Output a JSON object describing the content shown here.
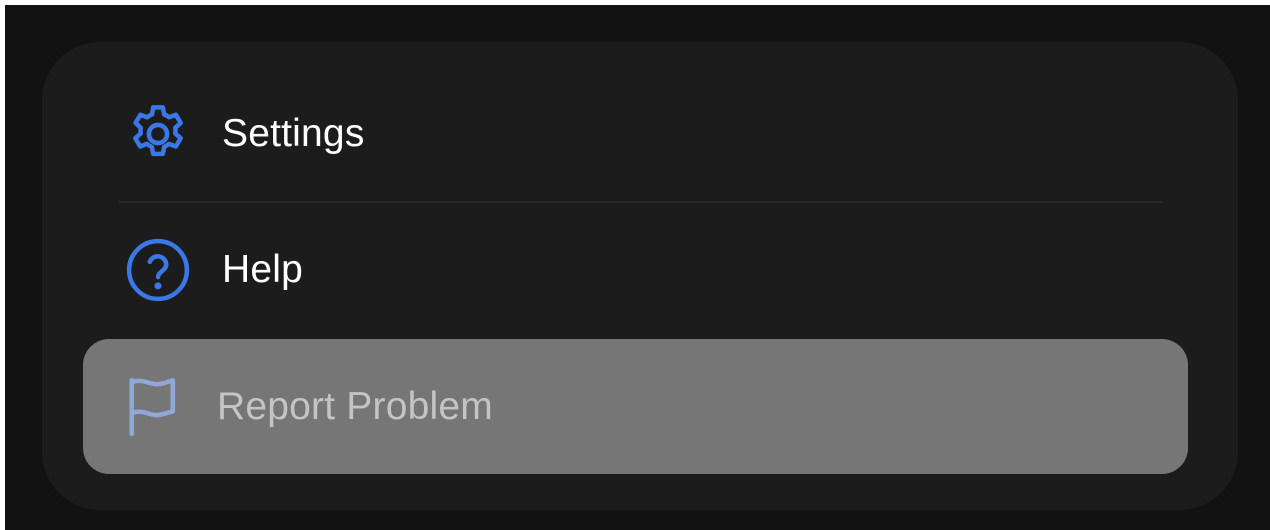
{
  "menu": {
    "items": [
      {
        "label": "Settings",
        "icon": "gear-icon"
      },
      {
        "label": "Help",
        "icon": "question-circle-icon"
      },
      {
        "label": "Report Problem",
        "icon": "flag-icon",
        "state": "highlighted"
      }
    ]
  },
  "colors": {
    "page_background": "#121212",
    "card_background": "#1c1c1c",
    "accent": "#3b78e7",
    "highlight_background": "#767676",
    "highlight_text": "#c4c4c4",
    "highlight_icon": "#8fa8d6"
  }
}
